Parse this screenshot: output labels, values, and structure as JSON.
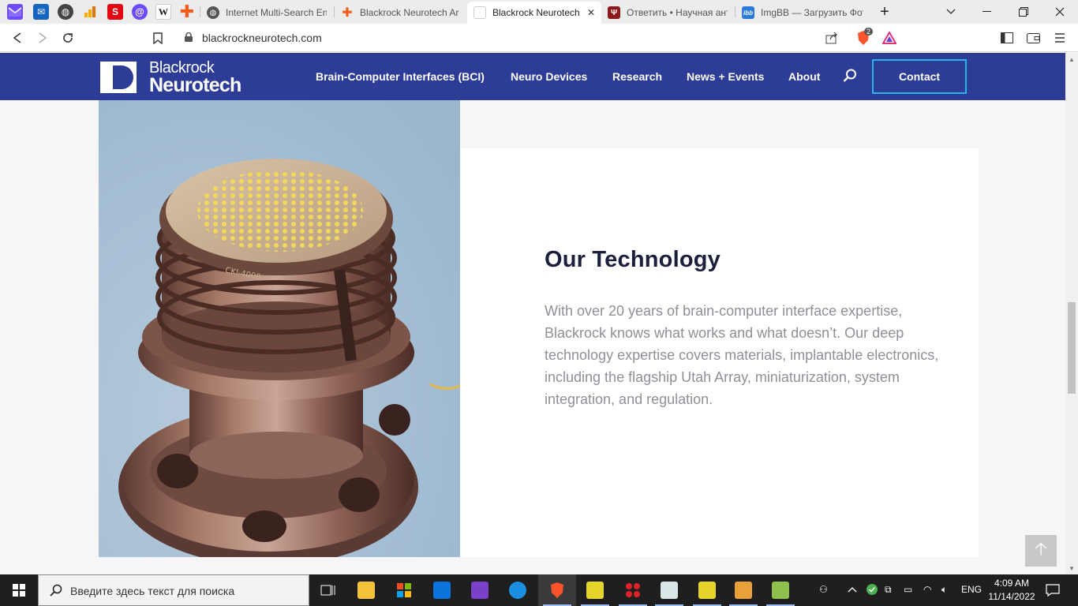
{
  "browser": {
    "tabs": [
      {
        "title": "Internet Multi-Search Eng",
        "favicon": "globe-icon"
      },
      {
        "title": "Blackrock Neurotech Arc",
        "favicon": "plus-icon"
      },
      {
        "title": "Blackrock Neurotech",
        "favicon": "blackrock-icon",
        "active": true,
        "close": "✕"
      },
      {
        "title": "Ответить • Научная анти",
        "favicon": "trident-icon"
      },
      {
        "title": "ImgBB — Загрузить Фот",
        "favicon": "ibb-icon"
      }
    ],
    "pinned_icons": [
      "proton-mail-icon",
      "outlook-icon",
      "globe-icon",
      "analytics-icon",
      "bank-icon",
      "at-icon",
      "wikipedia-icon",
      "plus-icon"
    ],
    "new_tab": "+",
    "address": "blackrockneurotech.com",
    "brave_badge": "2"
  },
  "site": {
    "logo": {
      "line1": "Blackrock",
      "line2": "Neurotech"
    },
    "nav": [
      "Brain-Computer Interfaces (BCI)",
      "Neuro Devices",
      "Research",
      "News + Events",
      "About"
    ],
    "contact": "Contact"
  },
  "content": {
    "heading": "Our Technology",
    "body": "With over 20 years of brain-computer interface expertise, Blackrock knows what works and what doesn’t. Our deep technology expertise covers materials, implantable electronics, including the flagship Utah Array, miniaturization, system integration, and regulation.",
    "photo_label": "CKI-4000",
    "to_top": "🡡"
  },
  "taskbar": {
    "search_placeholder": "Введите здесь текст для поиска",
    "language": "ENG",
    "time": "4:09 AM",
    "date": "11/14/2022"
  },
  "colors": {
    "header_blue": "#2d3c97",
    "contact_border": "#2ab4e8",
    "heading": "#1b1f3b",
    "body_text": "#8f8f96"
  }
}
